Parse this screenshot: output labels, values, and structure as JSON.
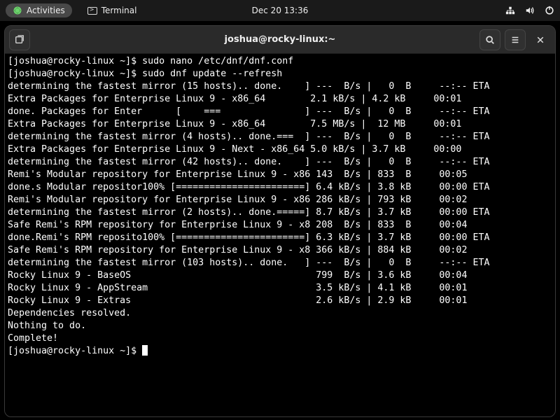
{
  "topbar": {
    "activities_label": "Activities",
    "app_label": "Terminal",
    "datetime": "Dec 20  13:36"
  },
  "window": {
    "title": "joshua@rocky-linux:~"
  },
  "terminal": {
    "lines": [
      "[joshua@rocky-linux ~]$ sudo nano /etc/dnf/dnf.conf",
      "[joshua@rocky-linux ~]$ sudo dnf update --refresh",
      "determining the fastest mirror (15 hosts).. done.    ] ---  B/s |   0  B     --:-- ETA",
      "Extra Packages for Enterprise Linux 9 - x86_64        2.1 kB/s | 4.2 kB     00:01    ",
      "done. Packages for Enter      [    ===               ] ---  B/s |   0  B     --:-- ETA",
      "Extra Packages for Enterprise Linux 9 - x86_64        7.5 MB/s |  12 MB     00:01    ",
      "determining the fastest mirror (4 hosts).. done.===  ] ---  B/s |   0  B     --:-- ETA",
      "Extra Packages for Enterprise Linux 9 - Next - x86_64 5.0 kB/s | 3.7 kB     00:00    ",
      "determining the fastest mirror (42 hosts).. done.    ] ---  B/s |   0  B     --:-- ETA",
      "Remi's Modular repository for Enterprise Linux 9 - x86 143  B/s | 833  B     00:05    ",
      "done.s Modular repositor100% [=======================] 6.4 kB/s | 3.8 kB     00:00 ETA",
      "Remi's Modular repository for Enterprise Linux 9 - x86 286 kB/s | 793 kB     00:02    ",
      "determining the fastest mirror (2 hosts).. done.=====] 8.7 kB/s | 3.7 kB     00:00 ETA",
      "Safe Remi's RPM repository for Enterprise Linux 9 - x8 208  B/s | 833  B     00:04    ",
      "done.Remi's RPM reposito100% [=======================] 6.3 kB/s | 3.7 kB     00:00 ETA",
      "Safe Remi's RPM repository for Enterprise Linux 9 - x8 366 kB/s | 884 kB     00:02    ",
      "determining the fastest mirror (103 hosts).. done.   ] ---  B/s |   0  B     --:-- ETA",
      "Rocky Linux 9 - BaseOS                                 799  B/s | 3.6 kB     00:04    ",
      "Rocky Linux 9 - AppStream                              3.5 kB/s | 4.1 kB     00:01    ",
      "Rocky Linux 9 - Extras                                 2.6 kB/s | 2.9 kB     00:01    ",
      "Dependencies resolved.",
      "Nothing to do.",
      "Complete!",
      "[joshua@rocky-linux ~]$ "
    ]
  }
}
